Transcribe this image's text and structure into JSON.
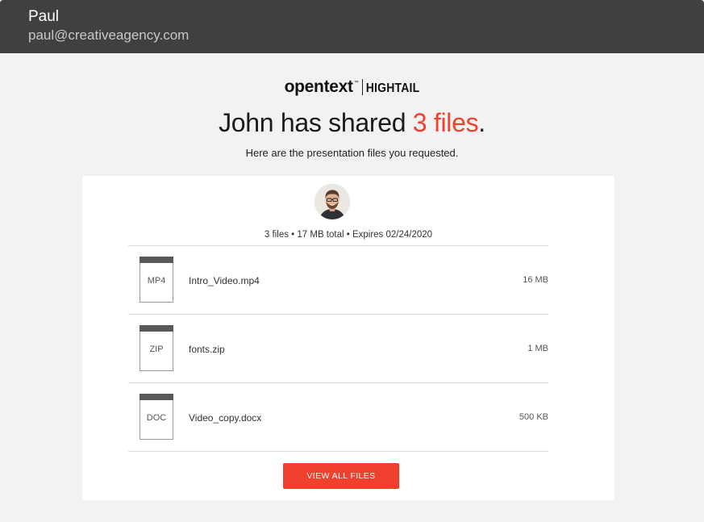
{
  "recipient": {
    "name": "Paul",
    "email": "paul@creativeagency.com"
  },
  "brand": {
    "primary": "opentext",
    "trademark": "™",
    "secondary": "HIGHTAIL",
    "accent_color": "#f0412e"
  },
  "share": {
    "headline_prefix": "John has shared ",
    "headline_count": "3 files",
    "headline_suffix": ".",
    "message": "Here are the presentation files you requested.",
    "meta": "3 files  • 17 MB total  • Expires 02/24/2020"
  },
  "files": [
    {
      "ext": "MP4",
      "name": "Intro_Video.mp4",
      "size": "16 MB"
    },
    {
      "ext": "ZIP",
      "name": "fonts.zip",
      "size": "1 MB"
    },
    {
      "ext": "DOC",
      "name": "Video_copy.docx",
      "size": "500 KB"
    }
  ],
  "actions": {
    "view_all": "VIEW ALL FILES"
  }
}
